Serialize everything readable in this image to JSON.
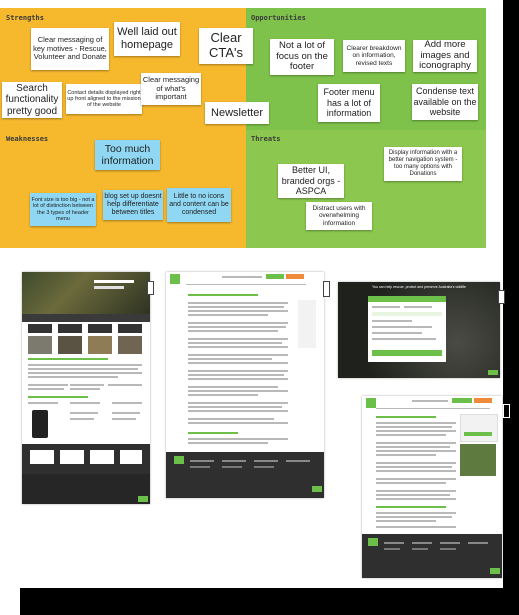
{
  "colors": {
    "strengths": "#f6b92e",
    "opportunities": "#7fc24b",
    "weaknesses": "#f6b92e",
    "threats": "#8cc84f",
    "note_white": "#ffffff",
    "note_blue": "#8fd7f3",
    "site_green": "#6cc04a",
    "footer_dark": "#2f2f2f"
  },
  "quadrants": {
    "strengths": {
      "title": "Strengths",
      "notes": [
        "Clear messaging of key motives - Rescue, Volunteer and Donate",
        "Well laid out homepage",
        "Search functionality pretty good",
        "Contact details displayed right up front aligned to the mission of the website",
        "Clear messaging of what's important"
      ]
    },
    "opportunities": {
      "title": "Opportunities",
      "notes": [
        "Clear CTA's",
        "Not a lot of focus on the footer",
        "Clearer breakdown on information, revised texts",
        "Add more images and iconography",
        "Newsletter",
        "Footer menu has a lot of information",
        "Condense text available on the website"
      ]
    },
    "weaknesses": {
      "title": "Weaknesses",
      "notes": [
        "Too much information",
        "Font size is too big - not a lot of distinction between the 3 types of header menu",
        "blog set up doesnt help differentiate between titles",
        "Little to no icons and content can be condensed"
      ]
    },
    "threats": {
      "title": "Threats",
      "notes": [
        "Better UI, branded orgs - ASPCA",
        "Display information with a better navigation system - too many options with Donations",
        "Distract users with overwhelming information"
      ]
    }
  },
  "screenshots": {
    "shot3_heading": "You can help rescue, protect and preserve Australia's wildlife"
  }
}
